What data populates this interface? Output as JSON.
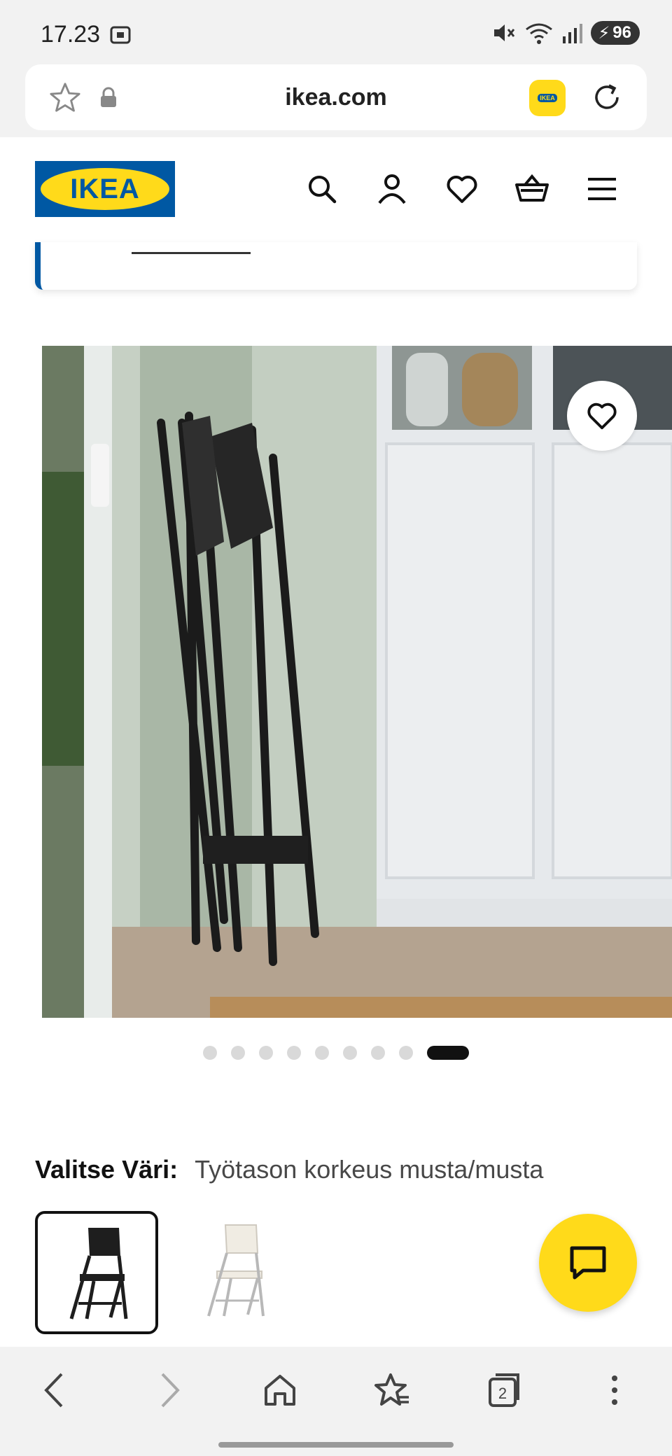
{
  "status_bar": {
    "time": "17.23",
    "battery": "96",
    "icons": [
      "screenshot-icon",
      "mute-icon",
      "wifi-icon",
      "signal-icon",
      "battery-icon"
    ]
  },
  "browser": {
    "url": "ikea.com",
    "icons": [
      "bookmark-star-icon",
      "lock-icon",
      "ikea-app-icon",
      "reload-icon"
    ],
    "tab_count": "2",
    "bottom_nav": [
      "back-icon",
      "forward-icon",
      "home-icon",
      "bookmarks-icon",
      "tabs-icon",
      "more-icon"
    ]
  },
  "header": {
    "logo_text": "IKEA",
    "icons": [
      "search-icon",
      "account-icon",
      "favourites-icon",
      "cart-icon",
      "menu-icon"
    ]
  },
  "gallery": {
    "image_count": 9,
    "active_index": 8
  },
  "color_select": {
    "label": "Valitse Väri:",
    "value": "Työtason korkeus musta/musta",
    "options": [
      "black-chair",
      "white-chair"
    ],
    "selected": 0
  },
  "colors": {
    "ikea_blue": "#0058a3",
    "ikea_yellow": "#ffda1a"
  }
}
